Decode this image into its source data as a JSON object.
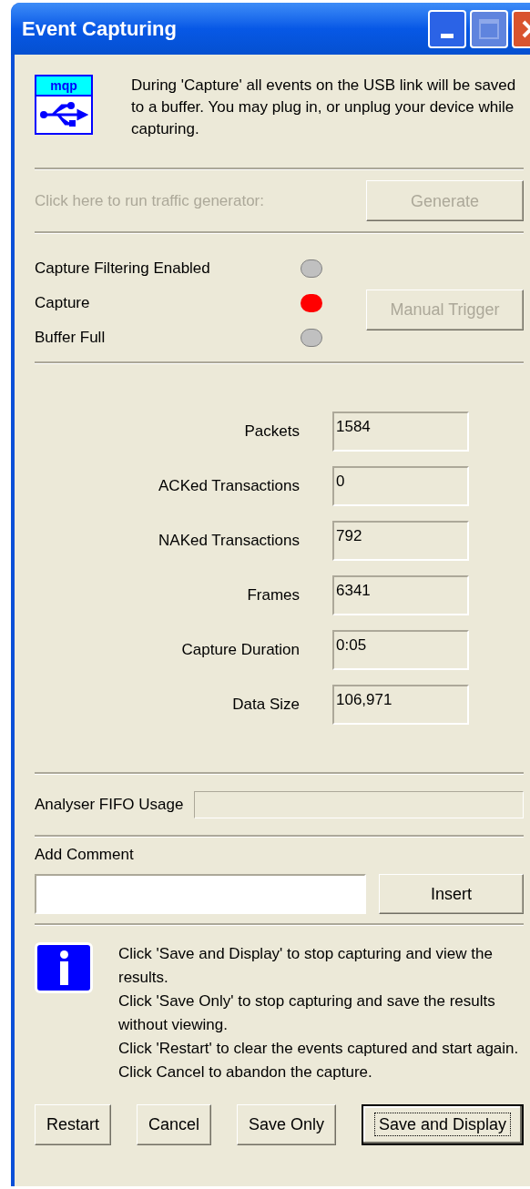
{
  "window": {
    "title": "Event Capturing",
    "controls": [
      {
        "kind": "minimize",
        "disabled": false
      },
      {
        "kind": "maximize",
        "disabled": true
      },
      {
        "kind": "close",
        "disabled": false
      }
    ]
  },
  "intro": {
    "logo_text": "mqp",
    "text": "During 'Capture' all events on the USB link will be saved to a buffer. You may plug in, or unplug your device while capturing."
  },
  "generator": {
    "label": "Click here to run traffic generator:",
    "button": "Generate",
    "disabled": true
  },
  "indicators": [
    {
      "label": "Capture Filtering Enabled",
      "lit": false,
      "color": "#c0c0c0"
    },
    {
      "label": "Capture",
      "lit": true,
      "color": "#ff0000"
    },
    {
      "label": "Buffer Full",
      "lit": false,
      "color": "#c0c0c0"
    }
  ],
  "manual_trigger": {
    "label": "Manual Trigger",
    "disabled": true
  },
  "stats": [
    {
      "label": "Packets",
      "value": "1584"
    },
    {
      "label": "ACKed Transactions",
      "value": "0"
    },
    {
      "label": "NAKed Transactions",
      "value": "792"
    },
    {
      "label": "Frames",
      "value": "6341"
    },
    {
      "label": "Capture Duration",
      "value": "0:05"
    },
    {
      "label": "Data Size",
      "value": "106,971"
    }
  ],
  "fifo": {
    "label": "Analyser FIFO Usage",
    "level": 0
  },
  "comment": {
    "label": "Add Comment",
    "button": "Insert"
  },
  "info": {
    "lines": [
      "Click 'Save and Display' to stop capturing and view the results.",
      "Click 'Save Only' to stop capturing and save the results without viewing.",
      "Click 'Restart' to clear the events captured and start again.",
      "Click Cancel to abandon the capture."
    ]
  },
  "buttons": [
    {
      "label": "Restart",
      "default": false
    },
    {
      "label": "Cancel",
      "default": false
    },
    {
      "label": "Save Only",
      "default": false
    },
    {
      "label": "Save and Display",
      "default": true
    }
  ]
}
